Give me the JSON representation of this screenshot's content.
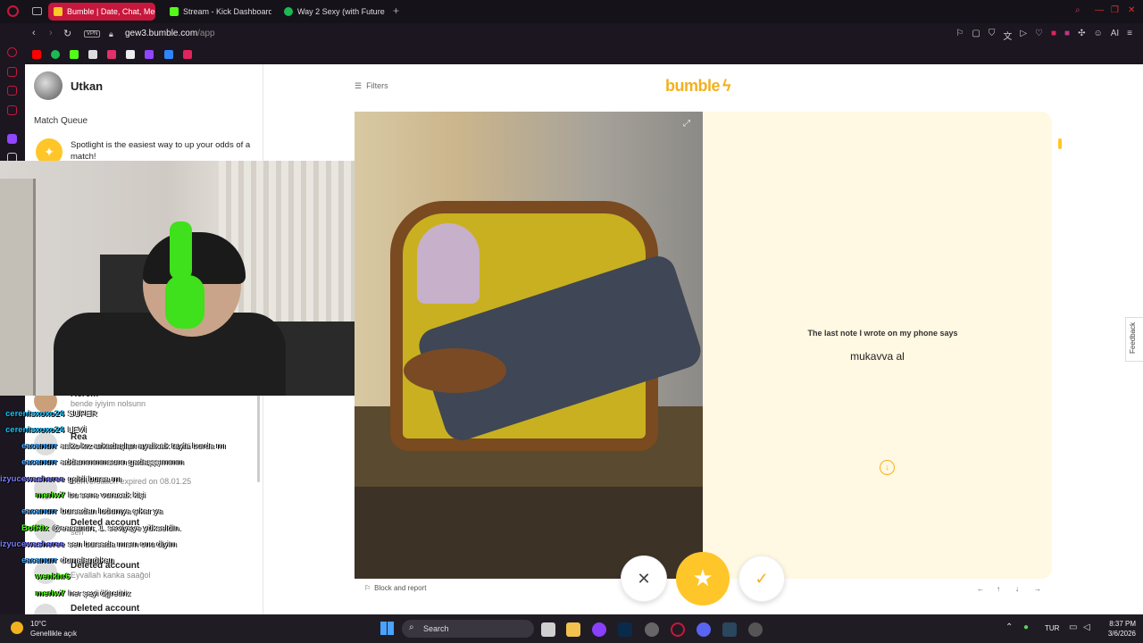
{
  "browser": {
    "tabs": [
      {
        "label": "Bumble | Date, Chat, Meet",
        "active": true,
        "color": "#ffc629"
      },
      {
        "label": "Stream - Kick Dashboard",
        "active": false,
        "color": "#53fc18"
      },
      {
        "label": "Way 2 Sexy (with Future &",
        "active": false,
        "color": "#1db954"
      }
    ],
    "vpn_label": "VPN",
    "url_domain": "gew3.bumble.com",
    "url_path": "/app",
    "ai_label": "AI"
  },
  "left": {
    "username": "Utkan",
    "match_queue": "Match Queue",
    "spotlight_text": "Spotlight is the easiest way to up your odds of a match!",
    "conversations": [
      {
        "name": "Kerem",
        "sub": "bende iyiyim nolsunn"
      },
      {
        "name": "Rea",
        "sub": "Conversation expired on 08.01.25"
      },
      {
        "name": "",
        "sub": "Conversation expired on 08.01.25"
      },
      {
        "name": "Deleted account",
        "sub": "sen"
      },
      {
        "name": "Deleted account",
        "sub": "Eyvallah kanka saağol"
      },
      {
        "name": "Deleted account",
        "sub": ""
      }
    ]
  },
  "chat": [
    {
      "user": "cerenisxoxo24",
      "msg": "SUPER",
      "color": "#19c3ff"
    },
    {
      "user": "cerenisxoxo24",
      "msg": "LEVİ",
      "color": "#19c3ff"
    },
    {
      "user": "eacanurr",
      "msg": "asko kız arkadaşları ayalicak tayfa burda mı",
      "color": "#3fa6ff"
    },
    {
      "user": "eacanurr",
      "msg": "addammmmsunn gadaşşşımmm",
      "color": "#3fa6ff"
    },
    {
      "user": "izyucewasheree",
      "msg": "geldi bursa mı",
      "color": "#7b7bff"
    },
    {
      "user": "merlw7",
      "msg": "bu sene vuracak kişi",
      "color": "#53fc18"
    },
    {
      "user": "eacanurr",
      "msg": "bursadan ludumya çıkar ya",
      "color": "#3fa6ff"
    },
    {
      "user": "BotRix",
      "msg": "@eacanurr, 1. seviyeye yükseldin.",
      "color": "#53fc18"
    },
    {
      "user": "izyucewasheree",
      "msg": "sen bursada mısın onu diyim",
      "color": "#7b7bff"
    },
    {
      "user": "eacanurr",
      "msg": "domalandıkan",
      "color": "#3fa6ff"
    },
    {
      "user": "wenkhr6",
      "msg": "",
      "color": "#53fc18"
    },
    {
      "user": "merlw7",
      "msg": "her şeyi öğretiriz",
      "color": "#53fc18"
    }
  ],
  "main": {
    "filters_label": "Filters",
    "logo_text": "bumble",
    "prompt_label": "The last note I wrote on my phone says",
    "prompt_answer": "mukavva al",
    "block_label": "Block and report",
    "feedback_label": "Feedback",
    "kbd_hints": [
      "←",
      "↑",
      "↓",
      "→"
    ],
    "accent": "#ffc629"
  },
  "taskbar": {
    "temp": "10°C",
    "weather": "Genellikle açık",
    "search_label": "Search",
    "lang": "TUR",
    "time": "8:37 PM",
    "date": "3/6/2026"
  }
}
